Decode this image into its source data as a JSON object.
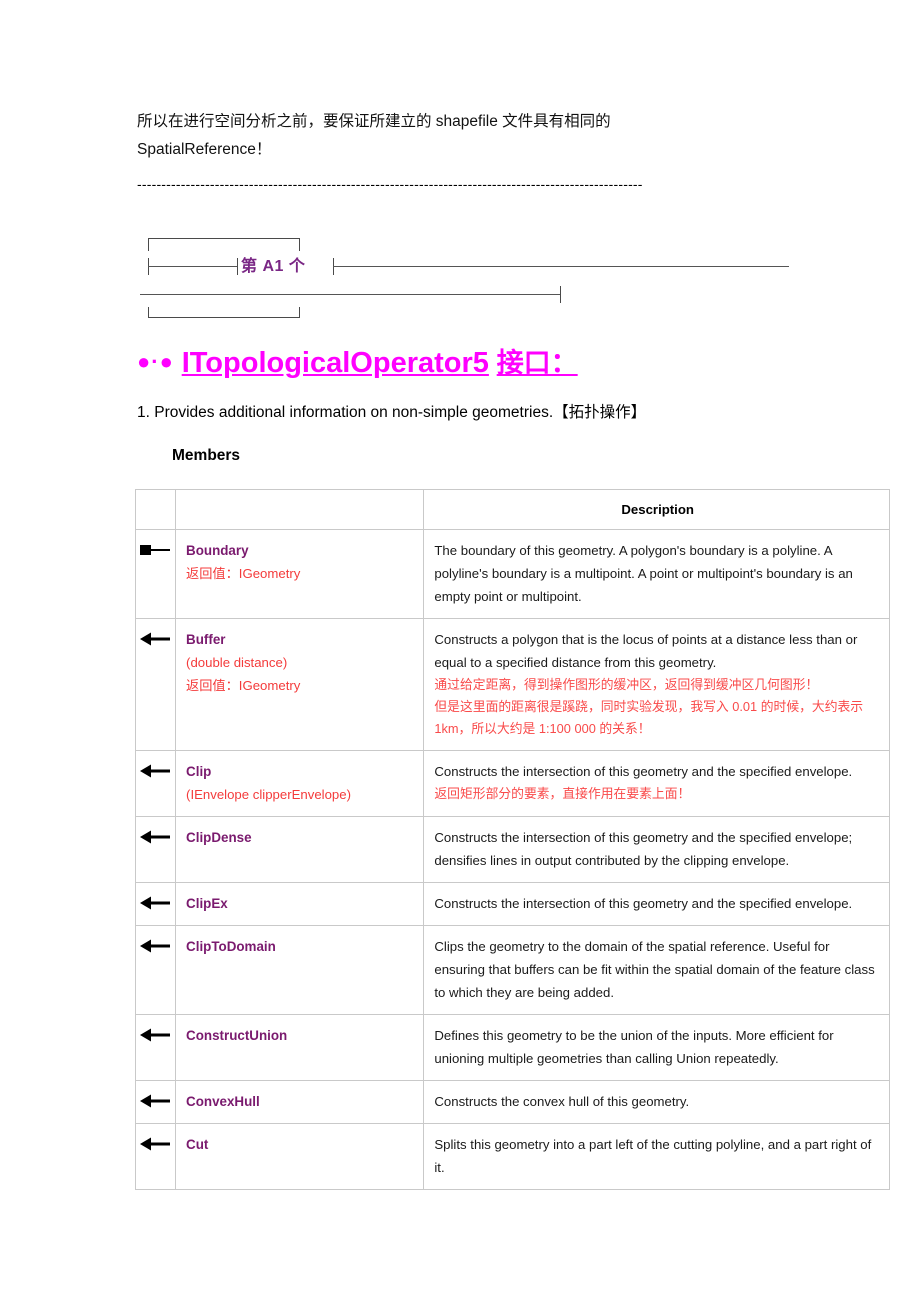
{
  "intro": {
    "line1": "所以在进行空间分析之前，要保证所建立的 shapefile 文件具有相同的",
    "line2": "SpatialReference！"
  },
  "separator": {
    "text": "--------------------------------------------------------------------------------------------------------"
  },
  "ornament": {
    "label": "第 A1 个",
    "label_color": "#7a2785"
  },
  "heading": {
    "bullets": "●·●",
    "title": "ITopologicalOperator5",
    "suffix": "接口：",
    "color": "#ff00ff"
  },
  "numbered_note": {
    "text": "1. Provides additional information on non-simple geometries.【拓扑操作】"
  },
  "members_label": "Members",
  "table": {
    "headers": [
      "",
      "",
      "Description"
    ],
    "rows": [
      {
        "icon": "method-square-icon",
        "name": "Boundary",
        "signature": "",
        "return": "返回值：IGeometry",
        "desc_en": "The boundary of this geometry. A polygon's boundary is a polyline. A polyline's boundary is a multipoint. A point or multipoint's boundary is an empty point or multipoint.",
        "desc_cn": []
      },
      {
        "icon": "arrow-left-icon",
        "name": "Buffer",
        "signature": "(double distance)",
        "return": "返回值：IGeometry",
        "desc_en": "Constructs a polygon that is the locus of points at a distance less than or equal to a specified distance from this geometry.",
        "desc_cn": [
          "通过给定距离，得到操作图形的缓冲区，返回得到缓冲区几何图形！",
          "但是这里面的距离很是蹊跷，同时实验发现，我写入 0.01 的时候，大约表示 1km，所以大约是 1:100 000 的关系！"
        ]
      },
      {
        "icon": "arrow-left-icon",
        "name": "Clip",
        "signature": "(IEnvelope clipperEnvelope)",
        "return": "",
        "desc_en": "Constructs the intersection of this geometry and the specified envelope.",
        "desc_cn": [
          "返回矩形部分的要素，直接作用在要素上面！"
        ]
      },
      {
        "icon": "arrow-left-icon",
        "name": "ClipDense",
        "signature": "",
        "return": "",
        "desc_en": "Constructs the intersection of this geometry and the specified envelope; densifies lines in output contributed by the clipping envelope.",
        "desc_cn": []
      },
      {
        "icon": "arrow-left-icon",
        "name": "ClipEx",
        "signature": "",
        "return": "",
        "desc_en": "Constructs the intersection of this geometry and the specified envelope.",
        "desc_cn": []
      },
      {
        "icon": "arrow-left-icon",
        "name": "ClipToDomain",
        "signature": "",
        "return": "",
        "desc_en": "Clips the geometry to the domain of the spatial reference. Useful for ensuring that buffers can be fit within the spatial domain of the feature class to which they are being added.",
        "desc_cn": []
      },
      {
        "icon": "arrow-left-icon",
        "name": "ConstructUnion",
        "signature": "",
        "return": "",
        "desc_en": "Defines this geometry to be the union of the inputs. More efficient for unioning multiple geometries than calling Union repeatedly.",
        "desc_cn": []
      },
      {
        "icon": "arrow-left-icon",
        "name": "ConvexHull",
        "signature": "",
        "return": "",
        "desc_en": "Constructs the convex hull of this geometry.",
        "desc_cn": []
      },
      {
        "icon": "arrow-left-icon",
        "name": "Cut",
        "signature": "",
        "return": "",
        "desc_en": "Splits this geometry into a part left of the cutting polyline, and a part right of it.",
        "desc_cn": []
      }
    ]
  },
  "colors": {
    "member_purple": "#7a1a6e",
    "annotation_red": "#f94a4a",
    "heading_magenta": "#ff00ff",
    "ornament_purple": "#7a2785",
    "table_border": "#c9c9c9"
  }
}
